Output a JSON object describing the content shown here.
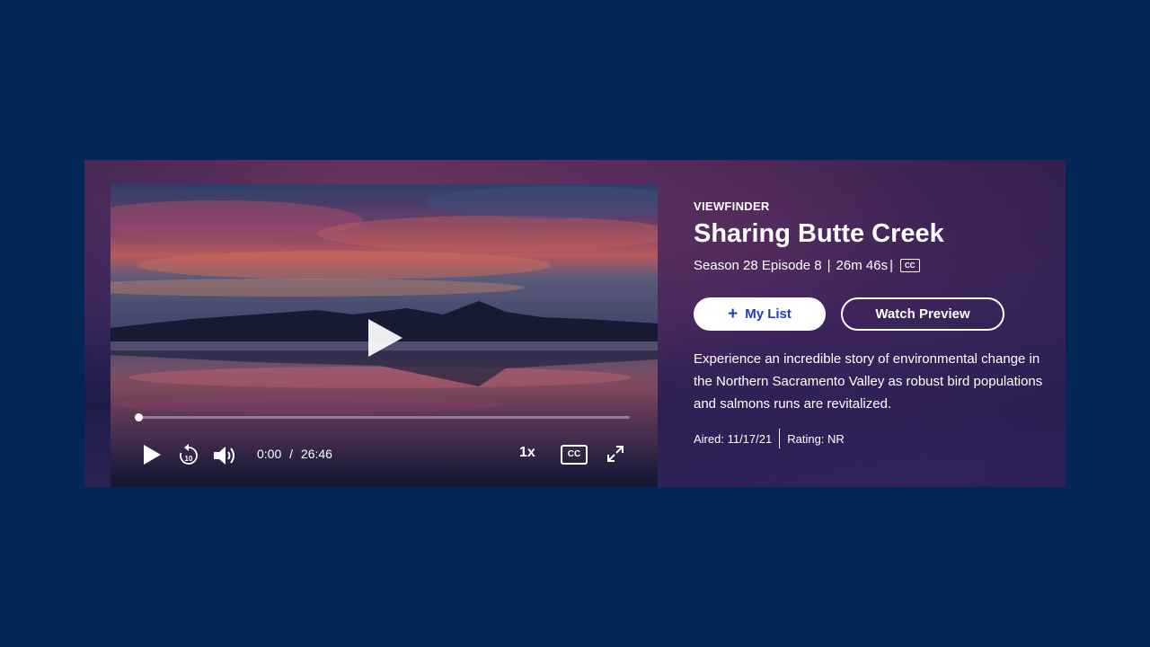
{
  "colors": {
    "page_background": "#022655",
    "accent_blue": "#2638c4",
    "text": "#ffffff"
  },
  "player": {
    "current_time": "0:00",
    "time_separator": "/",
    "duration": "26:46",
    "progress_fraction": 0.0,
    "speed_label": "1x",
    "cc_label": "CC",
    "icons": {
      "center": "play-icon",
      "play": "play-icon",
      "rewind": "rewind-10-icon",
      "volume": "volume-icon",
      "fullscreen": "fullscreen-icon"
    },
    "rewind_label": "10"
  },
  "info": {
    "show_title": "VIEWFINDER",
    "episode_title": "Sharing Butte Creek",
    "season_episode": "Season 28 Episode 8",
    "runtime": "26m 46s",
    "meta_sep": "|",
    "cc_badge": "CC",
    "mylist_plus": "+",
    "mylist_label": "My List",
    "preview_label": "Watch Preview",
    "description": "Experience an incredible story of environmental change in the Northern Sacramento Valley as robust bird populations and salmons runs are revitalized.",
    "aired": "Aired: 11/17/21",
    "rating": "Rating: NR"
  }
}
